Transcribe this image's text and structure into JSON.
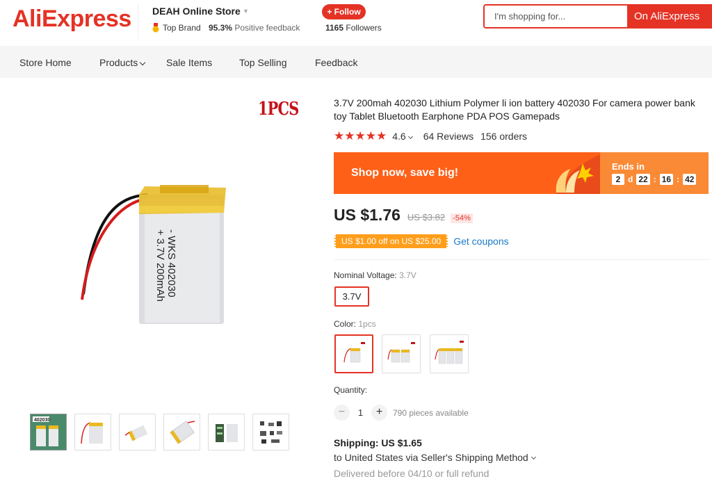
{
  "header": {
    "logo": "AliExpress",
    "store_name": "DEAH Online Store",
    "top_brand": "Top Brand",
    "feedback_pct": "95.3%",
    "feedback_label": "Positive feedback",
    "follow_label": "+ Follow",
    "followers_count": "1165",
    "followers_label": "Followers",
    "search_placeholder": "I'm shopping for...",
    "search_button": "On AliExpress"
  },
  "nav": {
    "items": [
      "Store Home",
      "Products",
      "Sale Items",
      "Top Selling",
      "Feedback"
    ]
  },
  "gallery": {
    "badge": "1PCS",
    "battery_lines": [
      "- WKS 402030",
      "+ 3.7V 200mAh"
    ],
    "thumb_label": "402030"
  },
  "product": {
    "title": "3.7V 200mah 402030 Lithium Polymer li ion battery 402030 For camera power bank toy Tablet Bluetooth Earphone PDA POS Gamepads",
    "rating": "4.6",
    "reviews": "64 Reviews",
    "orders": "156 orders",
    "banner_text": "Shop now, save big!",
    "ends_in": "Ends in",
    "timer": {
      "days": "2",
      "d_label": "d",
      "hours": "22",
      "minutes": "16",
      "seconds": "42"
    },
    "price": "US $1.76",
    "original_price": "US $3.82",
    "discount": "-54%",
    "coupon": "US $1.00 off on US $25.00",
    "get_coupons": "Get coupons",
    "voltage_label": "Nominal Voltage:",
    "voltage_value": "3.7V",
    "voltage_option": "3.7V",
    "color_label": "Color:",
    "color_value": "1pcs",
    "quantity_label": "Quantity:",
    "quantity": "1",
    "available": "790 pieces available",
    "shipping": "Shipping: US $1.65",
    "ship_to": "to United States via Seller's Shipping Method",
    "delivered": "Delivered before 04/10 or full refund"
  },
  "colors": {
    "brand_red": "#e43225",
    "banner_orange": "#fe6018",
    "coupon_orange": "#ff9e1b",
    "link_blue": "#1979c9"
  }
}
